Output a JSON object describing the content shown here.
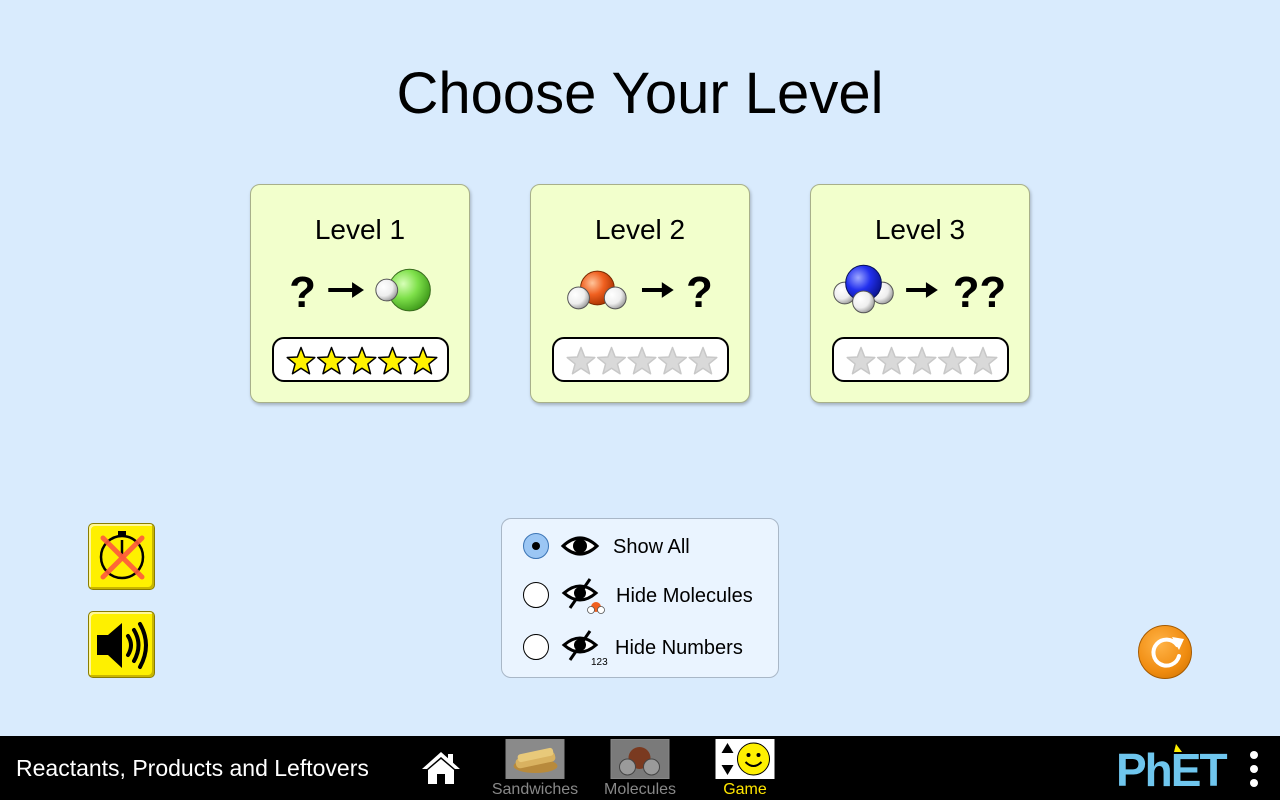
{
  "title": "Choose Your Level",
  "levels": [
    {
      "label": "Level 1",
      "icon_text": "?",
      "stars_earned": 5,
      "stars_total": 5
    },
    {
      "label": "Level 2",
      "icon_text": "?",
      "stars_earned": 0,
      "stars_total": 5
    },
    {
      "label": "Level 3",
      "icon_text": "??",
      "stars_earned": 0,
      "stars_total": 5
    }
  ],
  "controls": {
    "timer_toggle": {
      "icon": "timer-off-icon",
      "enabled": false
    },
    "sound_toggle": {
      "icon": "speaker-icon",
      "enabled": true
    }
  },
  "visibility": {
    "selected": "show_all",
    "options": [
      {
        "id": "show_all",
        "label": "Show All",
        "icon": "eye-icon",
        "selected": true
      },
      {
        "id": "hide_molecules",
        "label": "Hide Molecules",
        "icon": "eye-slash-molecule-icon",
        "selected": false
      },
      {
        "id": "hide_numbers",
        "label": "Hide Numbers",
        "icon": "eye-slash-numbers-icon",
        "icon_text": "123",
        "selected": false
      }
    ]
  },
  "navbar": {
    "app_title": "Reactants, Products and Leftovers",
    "screens": [
      {
        "label": "Sandwiches",
        "active": false
      },
      {
        "label": "Molecules",
        "active": false
      },
      {
        "label": "Game",
        "active": true
      }
    ],
    "brand": "PhET"
  },
  "colors": {
    "background": "#d9ebfd",
    "card": "#f2ffcc",
    "star_filled": "#fff200",
    "star_empty": "#d9d9d9",
    "button_yellow": "#fef000",
    "refresh_orange": "#f08c10",
    "active_screen": "#ffe600",
    "phet_blue": "#6fc6ee"
  }
}
